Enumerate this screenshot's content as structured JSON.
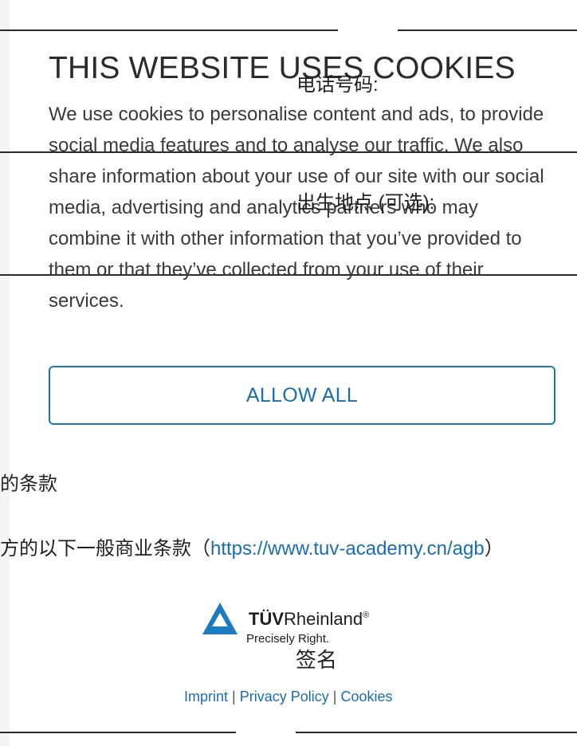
{
  "cookie_banner": {
    "title": "THIS WEBSITE USES COOKIES",
    "body": "We use cookies to personalise content and ads, to provide social media features and to analyse our traffic. We also share information about your use of our site with our social media, advertising and analytics partners who may combine it with other information that you’ve provided to them or that they’ve collected from your use of their services.",
    "allow_all_label": "ALLOW ALL"
  },
  "form": {
    "phone_label": "电话号码:",
    "birthplace_label": "出生地点 (可选):",
    "signature_label": "签名"
  },
  "terms": {
    "heading_fragment": "的条款",
    "line_prefix": "方的以下一般商业条款（",
    "link_text": "https://www.tuv-academy.cn/agb",
    "line_suffix": "）"
  },
  "logo": {
    "brand_bold": "TÜV",
    "brand_rest": "Rheinland",
    "registered_mark": "®",
    "tagline": "Precisely Right."
  },
  "footer": {
    "imprint": "Imprint",
    "privacy": "Privacy Policy",
    "cookies": "Cookies",
    "separator": "|"
  },
  "colors": {
    "accent": "#1a6eae",
    "button_border": "#1a78b7",
    "text": "#3a3a3a",
    "logo_blue": "#1d7cbf"
  }
}
